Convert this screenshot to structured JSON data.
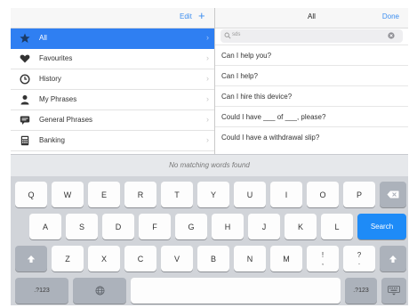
{
  "left_header": {
    "edit_label": "Edit",
    "add_label": "+"
  },
  "categories": [
    {
      "label": "All",
      "icon": "star-icon",
      "selected": true
    },
    {
      "label": "Favourites",
      "icon": "heart-icon",
      "selected": false
    },
    {
      "label": "History",
      "icon": "clock-icon",
      "selected": false
    },
    {
      "label": "My Phrases",
      "icon": "person-icon",
      "selected": false
    },
    {
      "label": "General Phrases",
      "icon": "speech-bubble-icon",
      "selected": false
    },
    {
      "label": "Banking",
      "icon": "calculator-icon",
      "selected": false
    }
  ],
  "right_header": {
    "title": "All",
    "done_label": "Done"
  },
  "search": {
    "value": "sds"
  },
  "phrases": [
    "Can I help you?",
    "Can I help?",
    "Can I hire this device?",
    "Could I have ___ of ___, please?",
    "Could I have a withdrawal slip?"
  ],
  "suggestion_bar": {
    "text": "No matching words found"
  },
  "keyboard": {
    "row1": [
      "Q",
      "W",
      "E",
      "R",
      "T",
      "Y",
      "U",
      "I",
      "O",
      "P"
    ],
    "row2": [
      "A",
      "S",
      "D",
      "F",
      "G",
      "H",
      "J",
      "K",
      "L"
    ],
    "row3": [
      "Z",
      "X",
      "C",
      "V",
      "B",
      "N",
      "M"
    ],
    "punct1": {
      "top": "!",
      "bottom": ","
    },
    "punct2": {
      "top": "?",
      "bottom": "."
    },
    "search_label": "Search",
    "numbers_label": ".?123",
    "numbers_label_right": ".?123",
    "icons": {
      "backspace": "backspace-icon",
      "shift": "shift-icon",
      "globe": "globe-icon",
      "hide_keyboard": "hide-keyboard-icon"
    }
  },
  "colors": {
    "accent": "#3d8ef0",
    "selected_row": "#2f7ff2",
    "search_key": "#1e8bf7"
  }
}
